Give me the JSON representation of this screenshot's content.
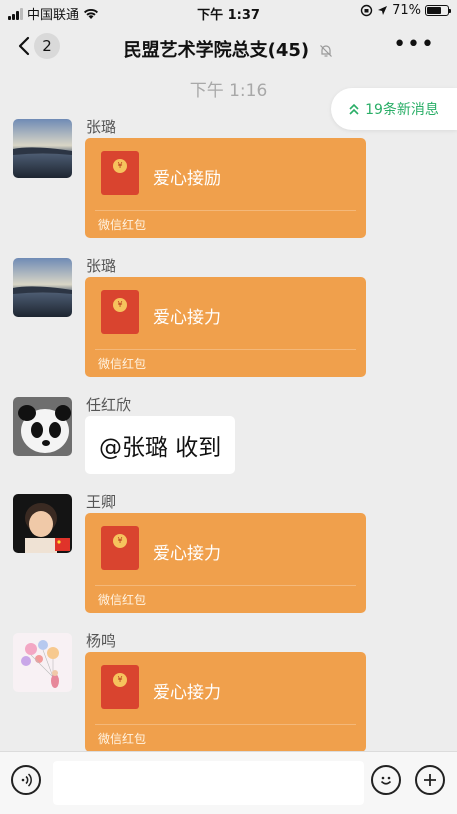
{
  "status": {
    "carrier": "中国联通",
    "time": "下午 1:37",
    "battery": "71%",
    "battery_level": 0.71
  },
  "nav": {
    "back_count": "2",
    "title": "民盟艺术学院总支(45)"
  },
  "chat": {
    "timestamp": "下午 1:16",
    "new_messages": "19条新消息",
    "messages": [
      {
        "sender": "张璐",
        "type": "redpacket",
        "title": "爱心接励",
        "footer": "微信红包"
      },
      {
        "sender": "张璐",
        "type": "redpacket",
        "title": "爱心接力",
        "footer": "微信红包"
      },
      {
        "sender": "任红欣",
        "type": "text",
        "text": "@张璐 收到"
      },
      {
        "sender": "王卿",
        "type": "redpacket",
        "title": "爱心接力",
        "footer": "微信红包"
      },
      {
        "sender": "杨鸣",
        "type": "redpacket",
        "title": "爱心接力",
        "footer": "微信红包"
      }
    ]
  },
  "colors": {
    "accent": "#2aae67",
    "redpacket": "#f0a04c",
    "background": "#ededed"
  },
  "icons": {
    "back": "chevron-left-icon",
    "mute": "bell-off-icon",
    "more": "more-icon",
    "voice": "voice-icon",
    "emoji": "emoji-icon",
    "plus": "plus-icon"
  }
}
